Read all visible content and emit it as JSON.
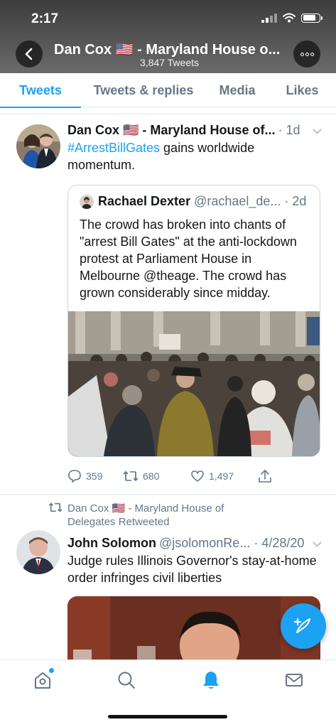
{
  "status_bar": {
    "time": "2:17"
  },
  "header": {
    "title": "Dan Cox 🇺🇸 - Maryland House o...",
    "subtitle": "3,847 Tweets"
  },
  "tabs": [
    {
      "label": "Tweets",
      "active": true
    },
    {
      "label": "Tweets & replies",
      "active": false
    },
    {
      "label": "Media",
      "active": false
    },
    {
      "label": "Likes",
      "active": false
    }
  ],
  "tweets": [
    {
      "author_name": "Dan Cox 🇺🇸 - Maryland House of...",
      "meta": "· 1d",
      "hashtag": "#ArrestBillGates",
      "text_after_hashtag": " gains worldwide momentum.",
      "quote": {
        "author_name": "Rachael Dexter",
        "meta": "@rachael_de... · 2d",
        "text": "The crowd has broken into chants of \"arrest Bill Gates\" at the anti-lockdown protest at Parliament House in Melbourne @theage. The crowd has grown considerably since midday."
      },
      "actions": {
        "replies": "359",
        "retweets": "680",
        "likes": "1,497"
      }
    },
    {
      "retweet_label": "Dan Cox 🇺🇸 - Maryland House of Delegates Retweeted",
      "author_name": "John Solomon",
      "meta": "@jsolomonRe... · 4/28/20",
      "text": "Judge rules Illinois Governor's stay-at-home order infringes civil liberties"
    }
  ],
  "colors": {
    "accent": "#1da1f2",
    "secondary_text": "#657786",
    "notification_dot": "#1da1f2"
  },
  "bottom_nav": [
    {
      "icon": "home-icon",
      "active": false
    },
    {
      "icon": "search-icon",
      "active": false
    },
    {
      "icon": "notifications-bell-icon",
      "active": true
    },
    {
      "icon": "messages-envelope-icon",
      "active": false
    }
  ],
  "fab": {
    "icon": "compose-feather-icon"
  }
}
